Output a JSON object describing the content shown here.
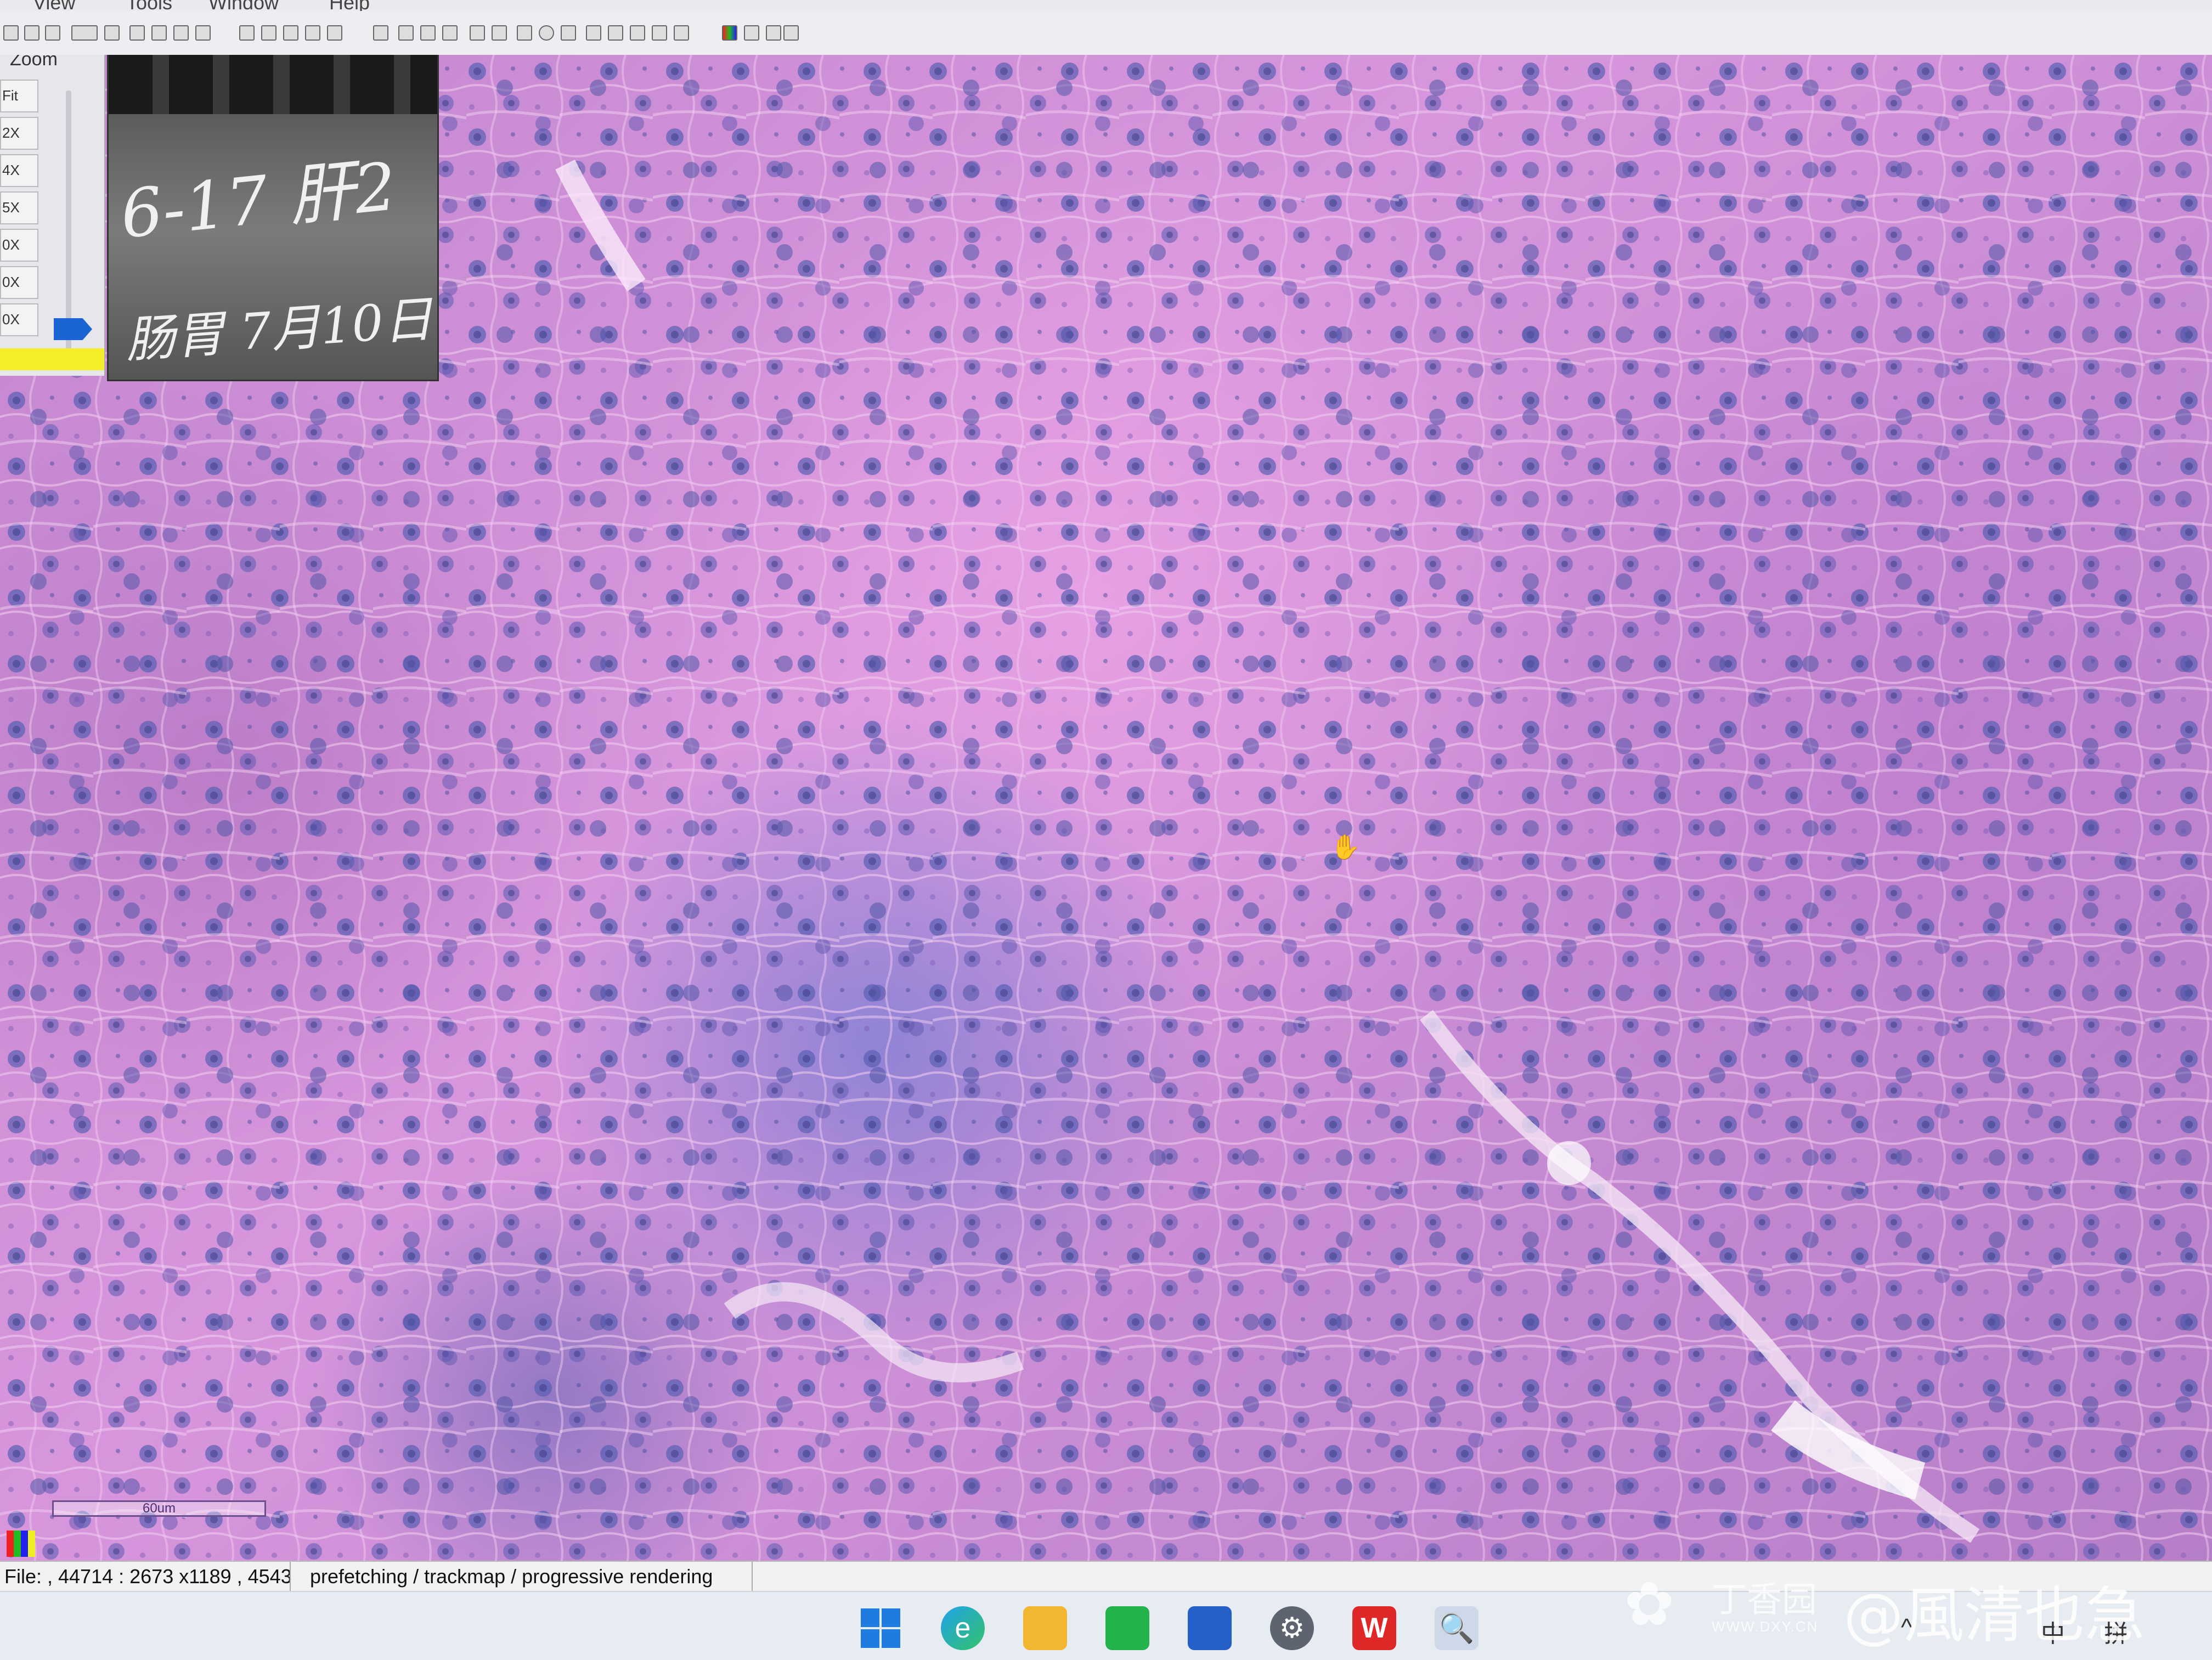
{
  "menu": {
    "items": [
      "View",
      "Tools",
      "Window",
      "Help"
    ]
  },
  "zoom_panel": {
    "title": "Zoom",
    "levels": [
      "Fit",
      "2X",
      "4X",
      "5X",
      "0X",
      "0X",
      "0X"
    ],
    "selected_level": "0X"
  },
  "thumbnail": {
    "label_line1": "6-17  肝2",
    "label_line2": "肠胃 7月10日"
  },
  "viewer": {
    "scale_bar_label": "60um"
  },
  "statusbar": {
    "coordinates": "File: , 44714 : 2673 x1189 , 4543",
    "message": "prefetching / trackmap / progressive rendering"
  },
  "taskbar": {
    "apps": [
      "start-icon",
      "edge-icon",
      "folder-icon",
      "store-bag-icon",
      "ms-store-icon",
      "settings-icon",
      "wps-icon",
      "search-magnifier-icon"
    ],
    "tray_ime": "中",
    "tray_ime2": "拼"
  },
  "watermark": {
    "logo_text": "丁香园",
    "url": "WWW.DXY.CN",
    "author": "@風清也急"
  },
  "colors": {
    "tissue_pink": "#d796dc",
    "nuclei_blue": "#4f5fb6",
    "zoom_marker": "#1a64d4",
    "zoom_highlight": "#f5ef2a"
  }
}
